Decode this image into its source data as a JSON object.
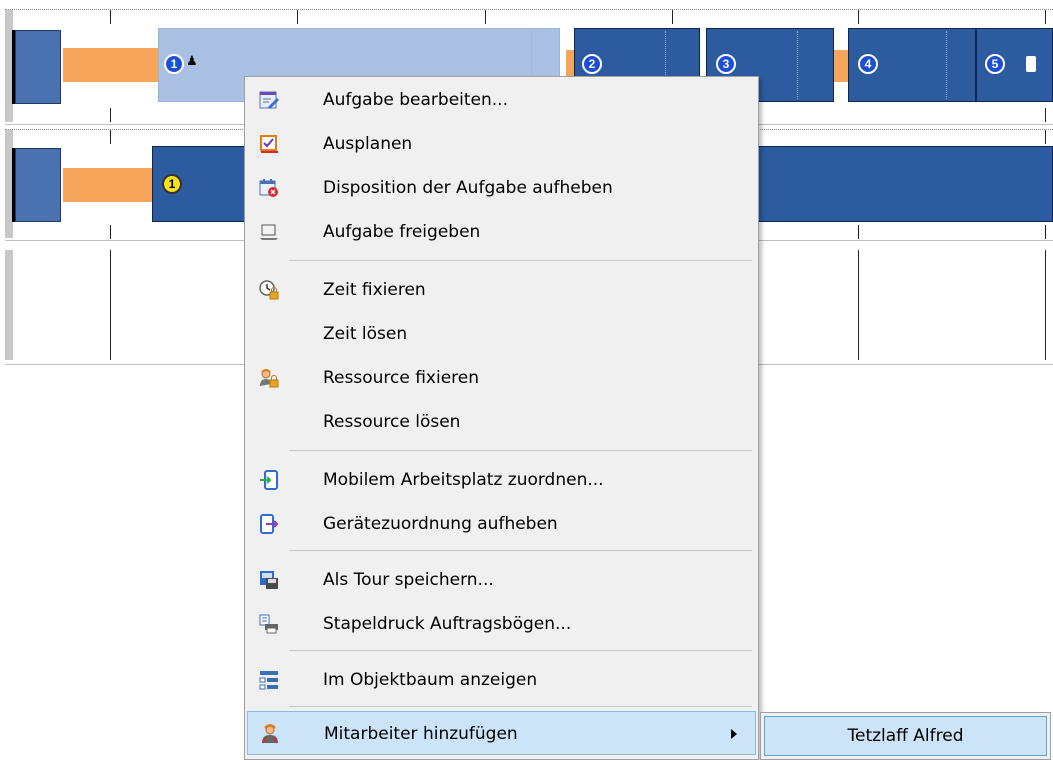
{
  "gantt": {
    "tasks_row1": [
      {
        "number": "1"
      },
      {
        "number": "2"
      },
      {
        "number": "3"
      },
      {
        "number": "4"
      },
      {
        "number": "5"
      }
    ],
    "tasks_row2": [
      {
        "number": "1"
      }
    ],
    "colors": {
      "task": "#2d5ba0",
      "task_selected": "#a9c0e2",
      "travel": "#f6a55a",
      "badge": "#1d4fd6",
      "badge_unconfirmed": "#f7e21a"
    }
  },
  "context_menu": {
    "items": [
      {
        "label": "Aufgabe bearbeiten...",
        "icon": "edit-task-icon"
      },
      {
        "label": "Ausplanen",
        "icon": "unschedule-icon"
      },
      {
        "label": "Disposition der Aufgabe aufheben",
        "icon": "cancel-dispatch-icon"
      },
      {
        "label": "Aufgabe freigeben",
        "icon": "release-task-icon"
      },
      {
        "label": "Zeit fixieren",
        "icon": "lock-time-icon"
      },
      {
        "label": "Zeit lösen",
        "icon": ""
      },
      {
        "label": "Ressource fixieren",
        "icon": "lock-resource-icon"
      },
      {
        "label": "Ressource lösen",
        "icon": ""
      },
      {
        "label": "Mobilem Arbeitsplatz zuordnen...",
        "icon": "assign-mobile-icon"
      },
      {
        "label": "Gerätezuordnung aufheben",
        "icon": "unassign-device-icon"
      },
      {
        "label": "Als Tour speichern...",
        "icon": "save-tour-icon"
      },
      {
        "label": "Stapeldruck Auftragsbögen...",
        "icon": "batch-print-icon"
      },
      {
        "label": "Im Objektbaum anzeigen",
        "icon": "object-tree-icon"
      },
      {
        "label": "Mitarbeiter hinzufügen",
        "icon": "add-employee-icon",
        "has_submenu": true,
        "highlighted": true
      }
    ]
  },
  "submenu": {
    "items": [
      {
        "label": "Tetzlaff Alfred",
        "highlighted": true
      }
    ]
  }
}
